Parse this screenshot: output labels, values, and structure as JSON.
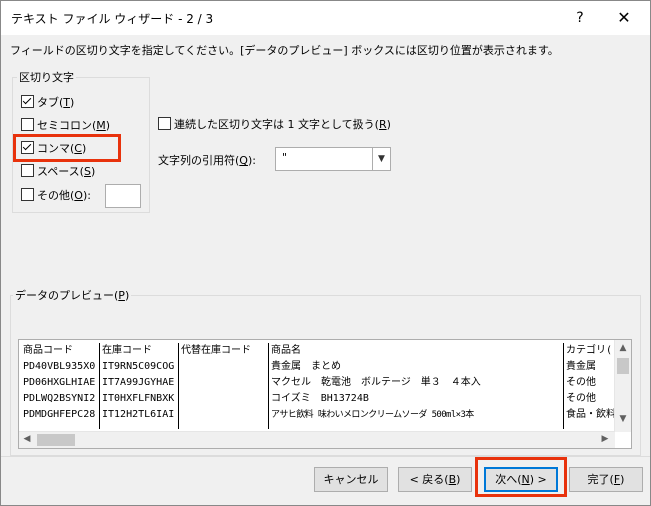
{
  "window": {
    "title": "テキスト ファイル ウィザード - 2 / 3",
    "help": "?",
    "close": "✕"
  },
  "instruction": "フィールドの区切り文字を指定してください。[データのプレビュー] ボックスには区切り位置が表示されます。",
  "delimiters": {
    "legend": "区切り文字",
    "items": [
      {
        "pre": "タブ(",
        "key": "T",
        "post": ")",
        "checked": true
      },
      {
        "pre": "セミコロン(",
        "key": "M",
        "post": ")",
        "checked": false
      },
      {
        "pre": "コンマ(",
        "key": "C",
        "post": ")",
        "checked": true
      },
      {
        "pre": "スペース(",
        "key": "S",
        "post": ")",
        "checked": false
      },
      {
        "pre": "その他(",
        "key": "O",
        "post": "):",
        "checked": false
      }
    ],
    "other_value": ""
  },
  "consecutive": {
    "pre": "連続した区切り文字は 1 文字として扱う(",
    "key": "R",
    "post": ")",
    "checked": false
  },
  "qualifier": {
    "pre": "文字列の引用符(",
    "key": "Q",
    "post": "):",
    "value": "\""
  },
  "preview": {
    "legend_pre": "データのプレビュー(",
    "legend_key": "P",
    "legend_post": ")",
    "columns": [
      [
        "商品コード",
        "PD40VBL935X0",
        "PD06HXGLHIAE",
        "PDLWQ2BSYNI2",
        "PDMDGHFEPC28"
      ],
      [
        "在庫コード",
        "IT9RN5C09COG",
        "IT7A99JGYHAE",
        "IT0HXFLFNBXK",
        "IT12H2TL6IAI"
      ],
      [
        "代替在庫コード",
        "",
        "",
        "",
        ""
      ],
      [
        "商品名",
        "貴金属　まとめ",
        "マクセル　乾電池　ボルテージ　単３　４本入",
        "コイズミ　BH13724B",
        "アサヒ飲料 味わいメロンクリームソーダ 500ml×3本"
      ],
      [
        "カテゴリ(",
        "貴金属",
        "その他",
        "その他",
        "食品・飲料"
      ]
    ]
  },
  "buttons": {
    "cancel": "キャンセル",
    "back_pre": "< 戻る(",
    "back_key": "B",
    "back_post": ")",
    "next_pre": "次へ(",
    "next_key": "N",
    "next_post": ") >",
    "finish_pre": "完了(",
    "finish_key": "F",
    "finish_post": ")"
  },
  "accent_colors": {
    "highlight": "#e8320c",
    "default_button": "#0078d7"
  }
}
